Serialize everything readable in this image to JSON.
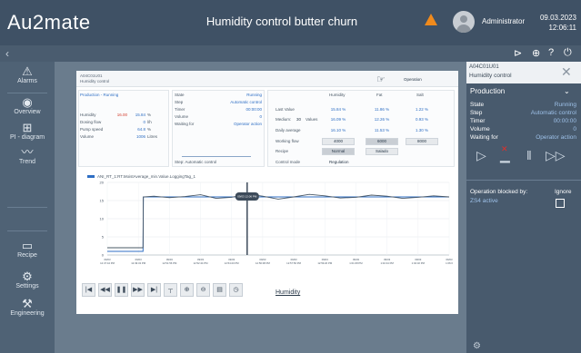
{
  "header": {
    "logo": "Au2mate",
    "title": "Humidity control butter churn",
    "user": "Administrator",
    "date": "09.03.2023",
    "time": "12:06:11"
  },
  "sidebar": {
    "items": [
      {
        "label": "Alarms",
        "icon": "alarm-triangle-icon"
      },
      {
        "label": "Overview",
        "icon": "eye-icon"
      },
      {
        "label": "PI - diagram",
        "icon": "diagram-icon"
      },
      {
        "label": "Trend",
        "icon": "trend-icon"
      },
      {
        "label": "Recipe",
        "icon": "document-icon"
      },
      {
        "label": "Settings",
        "icon": "gear-icon"
      },
      {
        "label": "Engineering",
        "icon": "wrench-icon"
      }
    ]
  },
  "panel": {
    "id": "A04C01U01",
    "subtitle": "Humidity control",
    "operation_label": "Operation",
    "production": {
      "title": "Production - Running",
      "rows": [
        {
          "label": "Humidity",
          "v1": "16.00",
          "v2": "15.84",
          "unit": "%"
        },
        {
          "label": "Dosing flow",
          "v2": "0",
          "unit": "l/h"
        },
        {
          "label": "Pump speed",
          "v2": "64.8",
          "unit": "%"
        },
        {
          "label": "Volume",
          "v2": "1006",
          "unit": "Litres"
        }
      ]
    },
    "state": {
      "rows": [
        {
          "label": "State",
          "value": "Running"
        },
        {
          "label": "Step",
          "value": "Automatic control"
        },
        {
          "label": "Timer",
          "value": "00:00:00"
        },
        {
          "label": "Volume",
          "value": "0"
        },
        {
          "label": "Waiting for",
          "value": "Operator action"
        }
      ],
      "step_footer": "Step:  Automatic control"
    },
    "values": {
      "headers": [
        "Humidity",
        "Fat",
        "Salt"
      ],
      "last_value": {
        "label": "Last Value",
        "cells": [
          "15.84 %",
          "11.86 %",
          "1.22 %"
        ]
      },
      "medium": {
        "label": "Medium:",
        "count": "30",
        "count_label": "Values",
        "cells": [
          "16.09 %",
          "12.26 %",
          "0.93 %"
        ]
      },
      "daily_average": {
        "label": "Daily average",
        "cells": [
          "16.10 %",
          "11.53 %",
          "1.30 %"
        ]
      },
      "working_flow": {
        "label": "Working flow",
        "cells": [
          "4000",
          "6000",
          "8000"
        ]
      },
      "recipe": {
        "label": "Recipe",
        "cells": [
          "Normal",
          "Salado"
        ]
      },
      "control_mode": {
        "label": "Control mode",
        "value": "Regulation"
      }
    }
  },
  "chart_data": {
    "type": "line",
    "legend": "ANI_RT_1:RT.MoistAverage_min.Value.LoggingTag_1",
    "cursor_label": "09/03 12:06 PM",
    "ylim": [
      0,
      20
    ],
    "yticks": [
      "20",
      "15",
      "10",
      "5",
      "0"
    ],
    "xticks": [
      "09/03 12:47:44 PM",
      "09/03 12:49:32 PM",
      "09/03 12:51:56 PM",
      "09/03 12:52:44 PM",
      "09/03 12:54:20 PM",
      "09/03 12:56:08 PM",
      "09/03 12:57:56 PM",
      "09/03 12:59:20 PM",
      "09/03 1:01:08 PM",
      "09/03 1:02:44 PM",
      "09/03 1:04:32 PM",
      "09/03 1:06:0"
    ],
    "series": [
      {
        "name": "ANI_RT_1:RT.MoistAverage_min.Value.LoggingTag_1",
        "color": "#2f6fc4",
        "x": [
          0,
          1.15,
          1.16,
          2,
          3,
          4,
          5,
          6,
          7,
          8,
          9,
          10,
          11
        ],
        "values": [
          1,
          1,
          16,
          16,
          16,
          16,
          16,
          16,
          16,
          16,
          16,
          16,
          16
        ]
      },
      {
        "name": "",
        "color": "#4a5866",
        "x": [
          0,
          1.15,
          1.16,
          1.5,
          2,
          2.5,
          3,
          3.5,
          4,
          4.5,
          5,
          5.5,
          6,
          6.5,
          7,
          7.5,
          8,
          8.5,
          9,
          9.5,
          10,
          10.5,
          11
        ],
        "values": [
          2,
          2,
          16,
          16.2,
          15.8,
          16.1,
          16.6,
          15.6,
          15.9,
          16.8,
          16.2,
          15.4,
          16.0,
          16.7,
          16.3,
          15.7,
          15.9,
          16.5,
          16.2,
          15.6,
          15.9,
          16.3,
          16.0
        ]
      }
    ]
  },
  "trend_toolbar": {
    "buttons": [
      {
        "icon": "first-icon",
        "glyph": "|◀"
      },
      {
        "icon": "rewind-icon",
        "glyph": "◀◀"
      },
      {
        "icon": "pause-icon",
        "glyph": "❚❚"
      },
      {
        "icon": "forward-icon",
        "glyph": "▶▶"
      },
      {
        "icon": "last-icon",
        "glyph": "▶|"
      },
      {
        "icon": "ruler-icon",
        "glyph": "┬"
      },
      {
        "icon": "zoom-in-icon",
        "glyph": "⊕"
      },
      {
        "icon": "zoom-out-icon",
        "glyph": "⊖"
      },
      {
        "icon": "table-icon",
        "glyph": "▤"
      },
      {
        "icon": "clock-icon",
        "glyph": "◷"
      }
    ],
    "link": "Humidity"
  },
  "right_panel": {
    "id": "A04C01U01",
    "subtitle": "Humidity control",
    "section": "Production",
    "rows": [
      {
        "label": "State",
        "value": "Running"
      },
      {
        "label": "Step",
        "value": "Automatic control"
      },
      {
        "label": "Timer",
        "value": "00:00:00"
      },
      {
        "label": "Volume",
        "value": "0"
      },
      {
        "label": "Waiting for",
        "value": "Operator action"
      }
    ],
    "blocked_label": "Operation blocked by:",
    "ignore_label": "Ignore",
    "blocked_reason": "ZS4 active"
  },
  "colors": {
    "topbar": "#3f5165",
    "sidebar": "#4f6275",
    "accent": "#2f6fc4",
    "warning": "#f08a1c",
    "alert": "#d23c2c"
  }
}
